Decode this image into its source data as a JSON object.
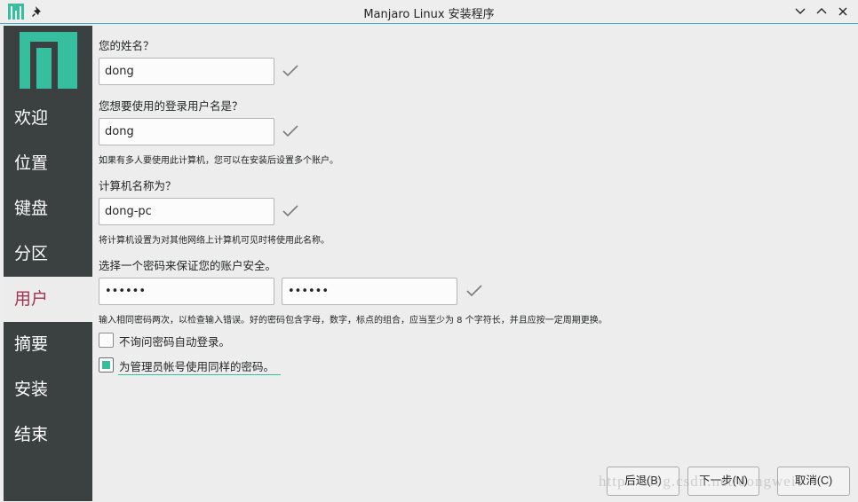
{
  "window": {
    "title": "Manjaro Linux 安装程序"
  },
  "sidebar": {
    "steps": [
      {
        "label": "欢迎"
      },
      {
        "label": "位置"
      },
      {
        "label": "键盘"
      },
      {
        "label": "分区"
      },
      {
        "label": "用户",
        "active": true
      },
      {
        "label": "摘要"
      },
      {
        "label": "安装"
      },
      {
        "label": "结束"
      }
    ]
  },
  "form": {
    "name_label": "您的姓名？",
    "name_value": "dong",
    "username_label": "您想要使用的登录用户名是？",
    "username_value": "dong",
    "username_note": "如果有多人要使用此计算机，您可以在安装后设置多个账户。",
    "hostname_label": "计算机名称为？",
    "hostname_value": "dong-pc",
    "hostname_note": "将计算机设置为对其他网络上计算机可见时将使用此名称。",
    "password_label": "选择一个密码来保证您的账户安全。",
    "password_value": "••••••",
    "password_confirm_value": "••••••",
    "password_note": "输入相同密码两次，以检查输入错误。好的密码包含字母，数字，标点的组合，应当至少为 8 个字符长，并且应按一定周期更换。",
    "autologin_label": "不询问密码自动登录。",
    "autologin_checked": false,
    "admin_same_label": "为管理员帐号使用同样的密码。",
    "admin_same_checked": true
  },
  "buttons": {
    "back": "后退(B)",
    "next": "下一步(N)",
    "cancel": "取消(C)"
  },
  "watermark": "http://blog.csdn.net/dongwei",
  "colors": {
    "accent": "#35bf9e",
    "sidebar": "#3b4041",
    "active_step": "#a3334d",
    "focus": "#3daee9"
  }
}
